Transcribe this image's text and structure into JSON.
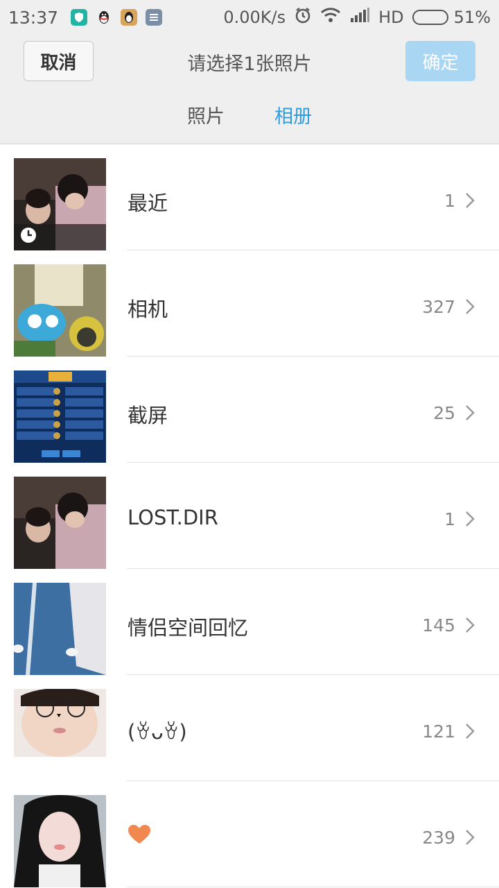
{
  "status_bar": {
    "time": "13:37",
    "speed": "0.00K/s",
    "network": "HD",
    "battery": "51%",
    "battery_level": 0.51,
    "icons": [
      "shield-app-icon",
      "qq-icon",
      "penguin-app-icon",
      "note-app-icon",
      "alarm-icon",
      "wifi-icon",
      "signal-icon",
      "battery-icon"
    ]
  },
  "header": {
    "cancel_label": "取消",
    "title": "请选择1张照片",
    "ok_label": "确定",
    "tabs": [
      {
        "label": "照片",
        "active": false
      },
      {
        "label": "相册",
        "active": true
      }
    ]
  },
  "albums": [
    {
      "name": "最近",
      "count": "1"
    },
    {
      "name": "相机",
      "count": "327"
    },
    {
      "name": "截屏",
      "count": "25"
    },
    {
      "name": "LOST.DIR",
      "count": "1"
    },
    {
      "name": "情侣空间回忆",
      "count": "145"
    },
    {
      "name": "(ꈊᴗꈊ)",
      "count": "121"
    },
    {
      "name": "",
      "count": "239",
      "icon": "heart-icon"
    }
  ],
  "colors": {
    "accent": "#2f9be0",
    "ok_button": "#a9d6f2",
    "heart": "#f0884f"
  }
}
